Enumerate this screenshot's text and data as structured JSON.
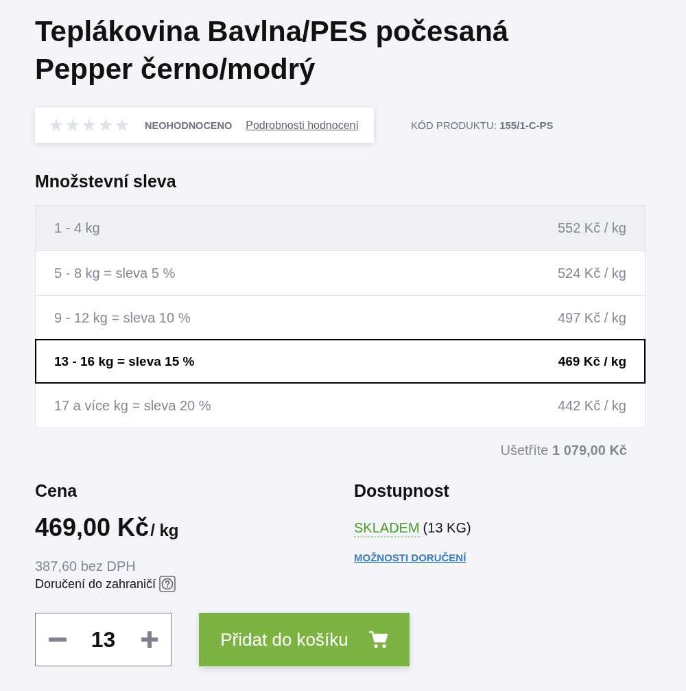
{
  "title": "Teplákovina Bavlna/PES počesaná Pepper černo/modrý",
  "rating": {
    "stars": 0,
    "status": "NEOHODNOCENO",
    "details_link": "Podrobnosti hodnocení"
  },
  "product_code": "KÓD PRODUKTU: **155/1-C-PS**",
  "quantity_discount": {
    "heading": "Množstevní sleva",
    "rows": [
      {
        "range": "1 - 4 kg",
        "price": "552 Kč / kg",
        "shaded": true,
        "selected": false
      },
      {
        "range": "5 - 8 kg = sleva 5 %",
        "price": "524 Kč / kg",
        "shaded": false,
        "selected": false
      },
      {
        "range": "9 - 12 kg = sleva 10 %",
        "price": "497 Kč / kg",
        "shaded": false,
        "selected": false
      },
      {
        "range": "13 - 16 kg = sleva 15 %",
        "price": "469 Kč / kg",
        "shaded": false,
        "selected": true
      },
      {
        "range": "17 a více kg = sleva 20 %",
        "price": "442 Kč / kg",
        "shaded": false,
        "selected": false
      }
    ],
    "savings": "Ušetříte **1 079,00 Kč**"
  },
  "price": {
    "heading": "Cena",
    "amount": "469,00 Kč",
    "unit": "/ kg",
    "without_vat": "387,60 bez DPH",
    "shipping_abroad": "Doručení do zahraničí"
  },
  "availability": {
    "heading": "Dostupnost",
    "status": "SKLADEM",
    "quantity": "(13 KG)",
    "delivery_link": "MOŽNOSTI DORUČENÍ"
  },
  "quantity": {
    "value": "13"
  },
  "add_to_cart": {
    "label": "Přidat do košíku"
  }
}
